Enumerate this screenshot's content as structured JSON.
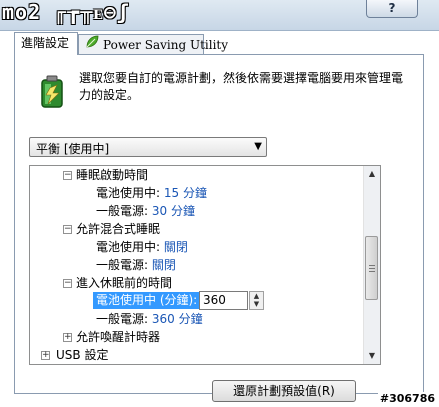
{
  "watermark": "mo2 ╓┲╥ᴇ⊖ʃ",
  "help_button": "?",
  "tabs": [
    {
      "label": "進階設定",
      "active": true
    },
    {
      "label": "Power Saving Utility",
      "active": false
    }
  ],
  "intro_text": "選取您要自訂的電源計劃，然後依需要選擇電腦要用來管理電力的設定。",
  "plan_select": {
    "value": "平衡 [使用中]"
  },
  "tree": {
    "sleep_timer": {
      "label": "睡眠啟動時間",
      "battery_label": "電池使用中:",
      "battery_value": "15 分鐘",
      "ac_label": "一般電源:",
      "ac_value": "30 分鐘"
    },
    "hybrid_sleep": {
      "label": "允許混合式睡眠",
      "battery_label": "電池使用中:",
      "battery_value": "關閉",
      "ac_label": "一般電源:",
      "ac_value": "關閉"
    },
    "hibernate": {
      "label": "進入休眠前的時間",
      "battery_label": "電池使用中 (分鐘):",
      "battery_input": "360",
      "ac_label": "一般電源:",
      "ac_value": "360 分鐘"
    },
    "wake_timers": {
      "label": "允許喚醒計時器"
    },
    "usb": {
      "label": "USB 設定"
    }
  },
  "restore_button": "還原計劃預設值(R)",
  "image_tag": "#306786",
  "colors": {
    "accent_blue": "#1a56b5",
    "selection": "#3399ff"
  },
  "icons": [
    "battery-power-icon",
    "leaf-icon",
    "expand-icon",
    "collapse-icon",
    "chevron-down-icon"
  ]
}
